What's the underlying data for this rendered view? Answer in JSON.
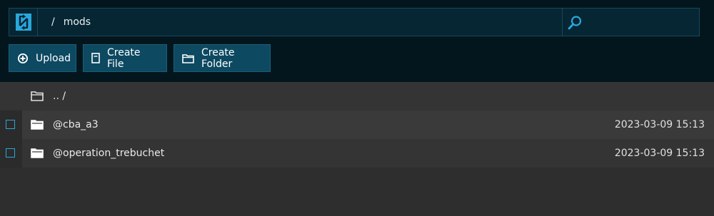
{
  "path": {
    "separator": "/",
    "current": "mods"
  },
  "icons": {
    "logo": "refresh-logo-icon",
    "search": "search-icon",
    "upload": "plus-circle-icon",
    "create_file": "file-icon",
    "create_folder": "folder-icon",
    "folder": "folder-icon"
  },
  "colors": {
    "accent": "#29a7dc",
    "button_bg": "#0d4961",
    "topbar_bg": "#04161d",
    "list_bg": "#2e2e2e"
  },
  "toolbar": {
    "upload_label": "Upload",
    "create_file_label": "Create File",
    "create_folder_label": "Create Folder"
  },
  "files": {
    "parent": {
      "name": ".. /"
    },
    "items": [
      {
        "name": "@cba_a3",
        "modified": "2023-03-09 15:13"
      },
      {
        "name": "@operation_trebuchet",
        "modified": "2023-03-09 15:13"
      }
    ]
  }
}
